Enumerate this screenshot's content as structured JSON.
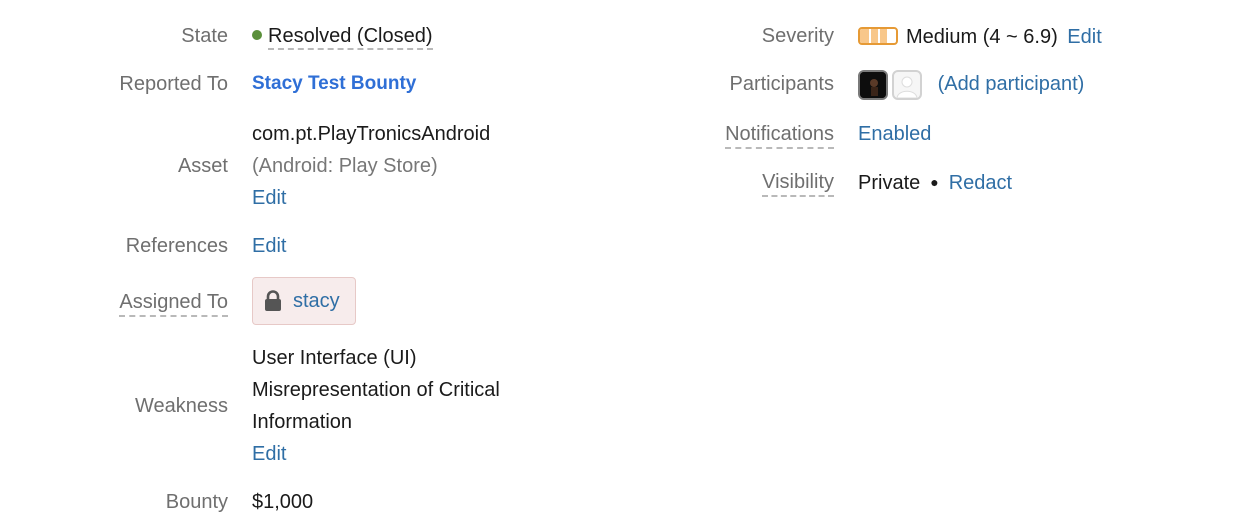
{
  "left": {
    "state": {
      "label": "State",
      "value": "Resolved (Closed)",
      "status_color": "#5a8f3a"
    },
    "reported_to": {
      "label": "Reported To",
      "value": "Stacy Test Bounty"
    },
    "asset": {
      "label": "Asset",
      "name": "com.pt.PlayTronicsAndroid",
      "type": "(Android: Play Store)",
      "edit": "Edit"
    },
    "references": {
      "label": "References",
      "edit": "Edit"
    },
    "assigned_to": {
      "label": "Assigned To",
      "value": "stacy",
      "icon": "lock-icon"
    },
    "weakness": {
      "label": "Weakness",
      "line1": "User Interface (UI)",
      "line2": "Misrepresentation of Critical",
      "line3": "Information",
      "edit": "Edit"
    },
    "bounty": {
      "label": "Bounty",
      "value": "$1,000"
    }
  },
  "right": {
    "severity": {
      "label": "Severity",
      "value": "Medium (4 ~ 6.9)",
      "edit": "Edit",
      "level": 0.75,
      "color": "#e69a35"
    },
    "participants": {
      "label": "Participants",
      "add": "(Add participant)"
    },
    "notifications": {
      "label": "Notifications",
      "value": "Enabled"
    },
    "visibility": {
      "label": "Visibility",
      "value": "Private",
      "action": "Redact"
    }
  }
}
